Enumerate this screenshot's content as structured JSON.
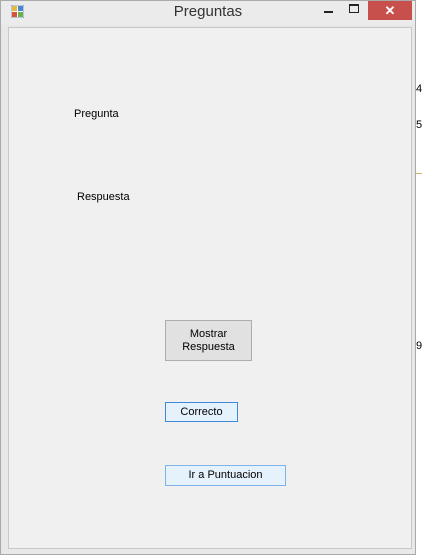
{
  "window": {
    "title": "Preguntas",
    "close_glyph": "✕"
  },
  "form": {
    "question_label": "Pregunta",
    "answer_label": "Respuesta",
    "show_answer_button": "Mostrar Respuesta",
    "correct_button": "Correcto",
    "go_to_score_button": "Ir a Puntuacion"
  },
  "background_window": {
    "edge_chars": [
      "4",
      "5",
      "9"
    ]
  },
  "colors": {
    "close_button": "#c7504c",
    "focused_border": "#3c8ad8",
    "button_face": "#e1e1e1",
    "form_background": "#f0f0f0"
  },
  "icons": [
    "app-form-icon",
    "minimize-icon",
    "maximize-icon",
    "close-icon"
  ]
}
